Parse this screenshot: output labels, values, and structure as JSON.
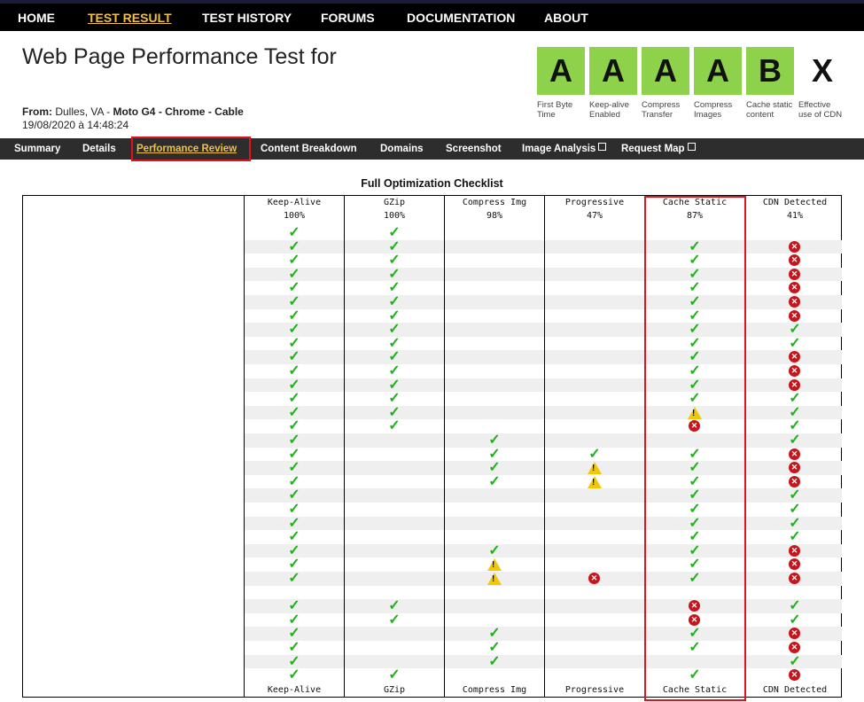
{
  "nav": {
    "items": [
      {
        "label": "HOME",
        "active": false
      },
      {
        "label": "TEST RESULT",
        "active": true
      },
      {
        "label": "TEST HISTORY",
        "active": false
      },
      {
        "label": "FORUMS",
        "active": false
      },
      {
        "label": "DOCUMENTATION",
        "active": false
      },
      {
        "label": "ABOUT",
        "active": false
      }
    ]
  },
  "header": {
    "title": "Web Page Performance Test for",
    "from_label": "From:",
    "location": "Dulles, VA",
    "separator1": " - ",
    "device": "Moto G4 - Chrome - Cable",
    "date": "19/08/2020 à 14:48:24"
  },
  "grades": [
    {
      "grade": "A",
      "label": "First Byte Time",
      "color": "#8ed14a"
    },
    {
      "grade": "A",
      "label": "Keep-alive Enabled",
      "color": "#8ed14a"
    },
    {
      "grade": "A",
      "label": "Compress Transfer",
      "color": "#8ed14a"
    },
    {
      "grade": "A",
      "label": "Compress Images",
      "color": "#8ed14a"
    },
    {
      "grade": "B",
      "label": "Cache static content",
      "color": "#8ed14a"
    },
    {
      "grade": "X",
      "label": "Effective use of CDN",
      "color": "#ffffff"
    }
  ],
  "subnav": {
    "items": [
      {
        "label": "Summary",
        "active": false,
        "external": false
      },
      {
        "label": "Details",
        "active": false,
        "external": false
      },
      {
        "label": "Performance Review",
        "active": true,
        "external": false
      },
      {
        "label": "Content Breakdown",
        "active": false,
        "external": false
      },
      {
        "label": "Domains",
        "active": false,
        "external": false
      },
      {
        "label": "Screenshot",
        "active": false,
        "external": false
      },
      {
        "label": "Image Analysis",
        "active": false,
        "external": true
      },
      {
        "label": "Request Map",
        "active": false,
        "external": true
      }
    ]
  },
  "checklist": {
    "title": "Full Optimization Checklist",
    "columns": [
      {
        "name": "Keep-Alive",
        "score": "100%"
      },
      {
        "name": "GZip",
        "score": "100%"
      },
      {
        "name": "Compress Img",
        "score": "98%"
      },
      {
        "name": "Progressive",
        "score": "47%"
      },
      {
        "name": "Cache Static",
        "score": "87%"
      },
      {
        "name": "CDN Detected",
        "score": "41%"
      }
    ],
    "rows": [
      [
        "pass",
        "pass",
        "",
        "",
        "",
        ""
      ],
      [
        "pass",
        "pass",
        "",
        "",
        "pass",
        "fail"
      ],
      [
        "pass",
        "pass",
        "",
        "",
        "pass",
        "fail"
      ],
      [
        "pass",
        "pass",
        "",
        "",
        "pass",
        "fail"
      ],
      [
        "pass",
        "pass",
        "",
        "",
        "pass",
        "fail"
      ],
      [
        "pass",
        "pass",
        "",
        "",
        "pass",
        "fail"
      ],
      [
        "pass",
        "pass",
        "",
        "",
        "pass",
        "fail"
      ],
      [
        "pass",
        "pass",
        "",
        "",
        "pass",
        "pass"
      ],
      [
        "pass",
        "pass",
        "",
        "",
        "pass",
        "pass"
      ],
      [
        "pass",
        "pass",
        "",
        "",
        "pass",
        "fail"
      ],
      [
        "pass",
        "pass",
        "",
        "",
        "pass",
        "fail"
      ],
      [
        "pass",
        "pass",
        "",
        "",
        "pass",
        "fail"
      ],
      [
        "pass",
        "pass",
        "",
        "",
        "pass",
        "pass"
      ],
      [
        "pass",
        "pass",
        "",
        "",
        "warn",
        "pass"
      ],
      [
        "pass",
        "pass",
        "",
        "",
        "fail",
        "pass"
      ],
      [
        "pass",
        "",
        "pass",
        "",
        "",
        "pass"
      ],
      [
        "pass",
        "",
        "pass",
        "pass",
        "pass",
        "fail"
      ],
      [
        "pass",
        "",
        "pass",
        "warn",
        "pass",
        "fail"
      ],
      [
        "pass",
        "",
        "pass",
        "warn",
        "pass",
        "fail"
      ],
      [
        "pass",
        "",
        "",
        "",
        "pass",
        "pass"
      ],
      [
        "pass",
        "",
        "",
        "",
        "pass",
        "pass"
      ],
      [
        "pass",
        "",
        "",
        "",
        "pass",
        "pass"
      ],
      [
        "pass",
        "",
        "",
        "",
        "pass",
        "pass"
      ],
      [
        "pass",
        "",
        "pass",
        "",
        "pass",
        "fail"
      ],
      [
        "pass",
        "",
        "warn",
        "",
        "pass",
        "fail"
      ],
      [
        "pass",
        "",
        "warn",
        "fail",
        "pass",
        "fail"
      ],
      [
        "",
        "",
        "",
        "",
        "",
        ""
      ],
      [
        "pass",
        "pass",
        "",
        "",
        "fail",
        "pass"
      ],
      [
        "pass",
        "pass",
        "",
        "",
        "fail",
        "pass"
      ],
      [
        "pass",
        "",
        "pass",
        "",
        "pass",
        "fail"
      ],
      [
        "pass",
        "",
        "pass",
        "",
        "pass",
        "fail"
      ],
      [
        "pass",
        "",
        "pass",
        "",
        "",
        "pass"
      ],
      [
        "pass",
        "pass",
        "",
        "",
        "pass",
        "fail"
      ]
    ]
  }
}
